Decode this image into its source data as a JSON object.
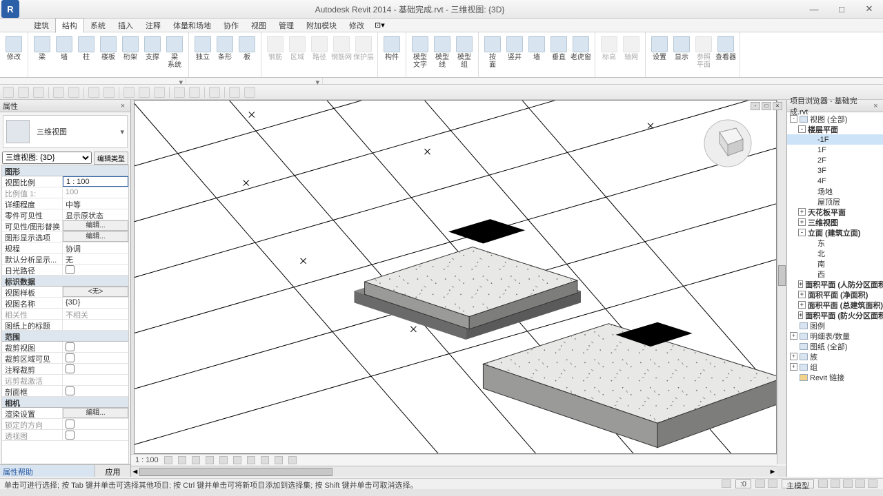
{
  "title": "Autodesk Revit 2014 -    基础完成.rvt - 三维视图: {3D}",
  "menu": [
    "建筑",
    "结构",
    "系统",
    "插入",
    "注释",
    "体量和场地",
    "协作",
    "视图",
    "管理",
    "附加模块",
    "修改"
  ],
  "menu_active": 1,
  "ribbon": [
    {
      "items": [
        {
          "l": "修改"
        }
      ]
    },
    {
      "items": [
        {
          "l": "梁"
        },
        {
          "l": "墙"
        },
        {
          "l": "柱"
        },
        {
          "l": "楼板"
        },
        {
          "l": "桁架"
        },
        {
          "l": "支撑"
        },
        {
          "l": "梁\n系统"
        }
      ]
    },
    {
      "items": [
        {
          "l": "独立"
        },
        {
          "l": "条形"
        },
        {
          "l": "板"
        }
      ]
    },
    {
      "items": [
        {
          "l": "钢筋",
          "d": true
        },
        {
          "l": "区域",
          "d": true
        },
        {
          "l": "路径",
          "d": true
        },
        {
          "l": "钢筋网",
          "d": true
        },
        {
          "l": "保护层",
          "d": true
        }
      ]
    },
    {
      "items": [
        {
          "l": "构件"
        }
      ]
    },
    {
      "items": [
        {
          "l": "模型\n文字"
        },
        {
          "l": "模型\n线"
        },
        {
          "l": "模型\n组"
        }
      ]
    },
    {
      "items": [
        {
          "l": "按\n面"
        },
        {
          "l": "竖井"
        },
        {
          "l": "墙"
        },
        {
          "l": "垂直"
        },
        {
          "l": "老虎窗"
        }
      ]
    },
    {
      "items": [
        {
          "l": "标高",
          "d": true
        },
        {
          "l": "轴网",
          "d": true
        }
      ]
    },
    {
      "items": [
        {
          "l": "设置"
        },
        {
          "l": "显示"
        },
        {
          "l": "参照\n平面",
          "d": true
        },
        {
          "l": "查看器"
        }
      ]
    }
  ],
  "props": {
    "title": "属性",
    "type": "三维视图",
    "instance": "三维视图: {3D}",
    "edit_type": "编辑类型",
    "groups": [
      {
        "h": "图形",
        "rows": [
          {
            "k": "视图比例",
            "v": "1 : 100",
            "sel": true
          },
          {
            "k": "比例值 1:",
            "v": "100",
            "dis": true
          },
          {
            "k": "详细程度",
            "v": "中等"
          },
          {
            "k": "零件可见性",
            "v": "显示原状态"
          },
          {
            "k": "可见性/图形替换",
            "v": "编辑...",
            "btn": true
          },
          {
            "k": "图形显示选项",
            "v": "编辑...",
            "btn": true
          },
          {
            "k": "规程",
            "v": "协调"
          },
          {
            "k": "默认分析显示...",
            "v": "无"
          },
          {
            "k": "日光路径",
            "cb": false
          }
        ]
      },
      {
        "h": "标识数据",
        "rows": [
          {
            "k": "视图样板",
            "v": "<无>",
            "btn": true
          },
          {
            "k": "视图名称",
            "v": "{3D}"
          },
          {
            "k": "相关性",
            "v": "不相关",
            "dis": true
          },
          {
            "k": "图纸上的标题",
            "v": ""
          }
        ]
      },
      {
        "h": "范围",
        "rows": [
          {
            "k": "裁剪视图",
            "cb": false
          },
          {
            "k": "裁剪区域可见",
            "cb": false
          },
          {
            "k": "注释裁剪",
            "cb": false
          },
          {
            "k": "远剪裁激活",
            "v": "",
            "dis": true
          },
          {
            "k": "剖面框",
            "cb": false
          }
        ]
      },
      {
        "h": "相机",
        "rows": [
          {
            "k": "渲染设置",
            "v": "编辑...",
            "btn": true
          },
          {
            "k": "锁定的方向",
            "cb": false,
            "dis": true
          },
          {
            "k": "透视图",
            "cb": false,
            "dis": true
          }
        ]
      }
    ],
    "help": "属性帮助",
    "apply": "应用"
  },
  "browser": {
    "title": "项目浏览器 - 基础完成.rvt",
    "tree": [
      {
        "t": "视图 (全部)",
        "l": 0,
        "e": "-",
        "ico": true
      },
      {
        "t": "楼层平面",
        "l": 1,
        "e": "-",
        "b": true
      },
      {
        "t": "-1F",
        "l": 2,
        "sel": true
      },
      {
        "t": "1F",
        "l": 2
      },
      {
        "t": "2F",
        "l": 2
      },
      {
        "t": "3F",
        "l": 2
      },
      {
        "t": "4F",
        "l": 2
      },
      {
        "t": "场地",
        "l": 2
      },
      {
        "t": "屋顶层",
        "l": 2
      },
      {
        "t": "天花板平面",
        "l": 1,
        "e": "+",
        "b": true
      },
      {
        "t": "三维视图",
        "l": 1,
        "e": "+",
        "b": true
      },
      {
        "t": "立面 (建筑立面)",
        "l": 1,
        "e": "-",
        "b": true
      },
      {
        "t": "东",
        "l": 2
      },
      {
        "t": "北",
        "l": 2
      },
      {
        "t": "南",
        "l": 2
      },
      {
        "t": "西",
        "l": 2
      },
      {
        "t": "面积平面 (人防分区面积",
        "l": 1,
        "e": "+",
        "b": true
      },
      {
        "t": "面积平面 (净面积)",
        "l": 1,
        "e": "+",
        "b": true
      },
      {
        "t": "面积平面 (总建筑面积)",
        "l": 1,
        "e": "+",
        "b": true
      },
      {
        "t": "面积平面 (防火分区面积",
        "l": 1,
        "e": "+",
        "b": true
      },
      {
        "t": "图例",
        "l": 0,
        "ico": true
      },
      {
        "t": "明细表/数量",
        "l": 0,
        "e": "+",
        "ico": true
      },
      {
        "t": "图纸 (全部)",
        "l": 0,
        "ico": true
      },
      {
        "t": "族",
        "l": 0,
        "e": "+",
        "ico": true
      },
      {
        "t": "组",
        "l": 0,
        "e": "+",
        "ico": true
      },
      {
        "t": "Revit 链接",
        "l": 0,
        "ico": true,
        "link": true
      }
    ]
  },
  "viewbar": {
    "scale": "1 : 100"
  },
  "status": "单击可进行选择; 按 Tab 键并单击可选择其他项目; 按 Ctrl 键并单击可将新项目添加到选择集; 按 Shift 键并单击可取消选择。",
  "status_right": {
    "zoom": ":0",
    "filter": "主模型"
  }
}
